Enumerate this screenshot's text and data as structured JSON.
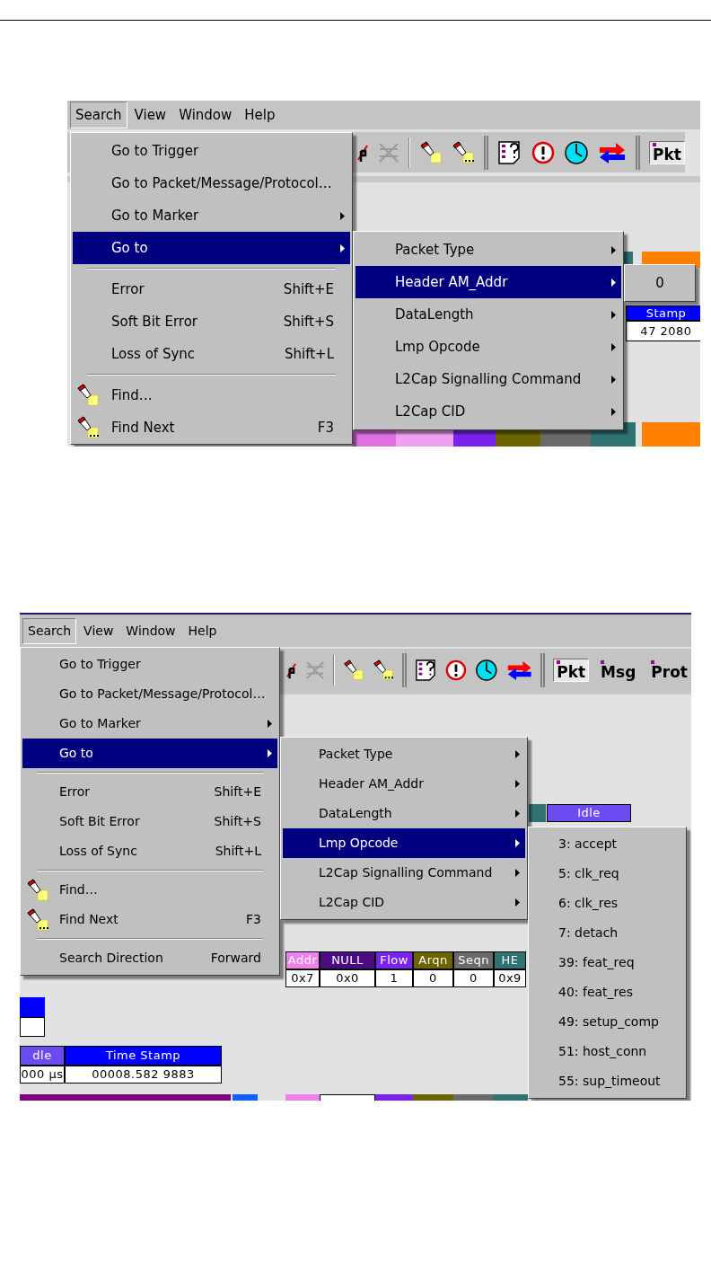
{
  "figures": [
    {
      "menu_bar": [
        {
          "label": "Search",
          "selected": true
        },
        {
          "label": "View",
          "selected": false
        },
        {
          "label": "Window",
          "selected": false
        },
        {
          "label": "Help",
          "selected": false
        }
      ],
      "toolbar_buttons": [
        {
          "label": "Pkt",
          "selected": true
        }
      ],
      "menu": [
        {
          "kind": "item",
          "label": "Go to Trigger",
          "submenu": false,
          "selected": false
        },
        {
          "kind": "item",
          "label": "Go to Packet/Message/Protocol…",
          "submenu": false,
          "selected": false
        },
        {
          "kind": "item",
          "label": "Go to Marker",
          "submenu": true,
          "selected": false
        },
        {
          "kind": "item",
          "label": "Go to",
          "submenu": true,
          "selected": true
        },
        {
          "kind": "separator"
        },
        {
          "kind": "item",
          "label": "Error",
          "shortcut": "Shift+E",
          "submenu": false,
          "selected": false
        },
        {
          "kind": "item",
          "label": "Soft Bit Error",
          "shortcut": "Shift+S",
          "submenu": false,
          "selected": false
        },
        {
          "kind": "item",
          "label": "Loss of Sync",
          "shortcut": "Shift+L",
          "submenu": false,
          "selected": false
        },
        {
          "kind": "separator"
        },
        {
          "kind": "flashlight_item",
          "label": "Find…",
          "submenu": false,
          "selected": false
        },
        {
          "kind": "flashlight_dots_item",
          "label": "Find Next",
          "shortcut": "F3",
          "submenu": false,
          "selected": false
        }
      ],
      "submenu": [
        {
          "label": "Packet Type",
          "submenu": true,
          "selected": false
        },
        {
          "label": "Header AM_Addr",
          "submenu": true,
          "selected": true
        },
        {
          "label": "DataLength",
          "submenu": true,
          "selected": false
        },
        {
          "label": "Lmp Opcode",
          "submenu": true,
          "selected": false
        },
        {
          "label": "L2Cap Signalling Command",
          "submenu": true,
          "selected": false
        },
        {
          "label": "L2Cap CID",
          "submenu": true,
          "selected": false
        }
      ],
      "subsubmenu": [
        {
          "label": "0",
          "submenu": false,
          "selected": false
        }
      ],
      "trace_tables": [
        {
          "headers": [
            {
              "text": "Stamp",
              "color": "#0000ff"
            }
          ],
          "values": [
            "47 2080"
          ]
        }
      ]
    },
    {
      "menu_bar": [
        {
          "label": "Search",
          "selected": true
        },
        {
          "label": "View",
          "selected": false
        },
        {
          "label": "Window",
          "selected": false
        },
        {
          "label": "Help",
          "selected": false
        }
      ],
      "toolbar_buttons": [
        {
          "label": "Pkt",
          "selected": true
        },
        {
          "label": "Msg",
          "selected": false
        },
        {
          "label": "Prot",
          "selected": false
        }
      ],
      "menu": [
        {
          "kind": "item",
          "label": "Go to Trigger",
          "submenu": false,
          "selected": false
        },
        {
          "kind": "item",
          "label": "Go to Packet/Message/Protocol…",
          "submenu": false,
          "selected": false
        },
        {
          "kind": "item",
          "label": "Go to Marker",
          "submenu": true,
          "selected": false
        },
        {
          "kind": "item",
          "label": "Go to",
          "submenu": true,
          "selected": true
        },
        {
          "kind": "separator"
        },
        {
          "kind": "item",
          "label": "Error",
          "shortcut": "Shift+E",
          "submenu": false,
          "selected": false
        },
        {
          "kind": "item",
          "label": "Soft Bit Error",
          "shortcut": "Shift+S",
          "submenu": false,
          "selected": false
        },
        {
          "kind": "item",
          "label": "Loss of Sync",
          "shortcut": "Shift+L",
          "submenu": false,
          "selected": false
        },
        {
          "kind": "separator"
        },
        {
          "kind": "flashlight_item",
          "label": "Find…",
          "submenu": false,
          "selected": false
        },
        {
          "kind": "flashlight_dots_item",
          "label": "Find Next",
          "shortcut": "F3",
          "submenu": false,
          "selected": false
        },
        {
          "kind": "separator"
        },
        {
          "kind": "item",
          "label": "Search Direction",
          "shortcut": "Forward",
          "submenu": false,
          "selected": false
        }
      ],
      "submenu": [
        {
          "label": "Packet Type",
          "submenu": true,
          "selected": false
        },
        {
          "label": "Header AM_Addr",
          "submenu": true,
          "selected": false
        },
        {
          "label": "DataLength",
          "submenu": true,
          "selected": false
        },
        {
          "label": "Lmp Opcode",
          "submenu": true,
          "selected": true
        },
        {
          "label": "L2Cap Signalling Command",
          "submenu": true,
          "selected": false
        },
        {
          "label": "L2Cap CID",
          "submenu": true,
          "selected": false
        }
      ],
      "subsubmenu": [
        {
          "label": "3: accept",
          "submenu": false,
          "selected": false
        },
        {
          "label": "5: clk_req",
          "submenu": false,
          "selected": false
        },
        {
          "label": "6: clk_res",
          "submenu": false,
          "selected": false
        },
        {
          "label": "7: detach",
          "submenu": false,
          "selected": false
        },
        {
          "label": "39: feat_req",
          "submenu": false,
          "selected": false
        },
        {
          "label": "40: feat_res",
          "submenu": false,
          "selected": false
        },
        {
          "label": "49: setup_comp",
          "submenu": false,
          "selected": false
        },
        {
          "label": "51: host_conn",
          "submenu": false,
          "selected": false
        },
        {
          "label": "55: sup_timeout",
          "submenu": false,
          "selected": false
        }
      ],
      "trace_tables": [
        {
          "headers": [
            {
              "text": "Idle",
              "color": "#6a4cf0"
            }
          ]
        },
        {
          "headers": [
            {
              "text": "Addr",
              "color": "#f080f0"
            },
            {
              "text": "NULL",
              "color": "#4b0c82"
            },
            {
              "text": "Flow",
              "color": "#7a22f0"
            },
            {
              "text": "Arqn",
              "color": "#6b6400"
            },
            {
              "text": "Seqn",
              "color": "#6a6a6a"
            },
            {
              "text": "HE",
              "color": "#2e7272"
            }
          ],
          "values": [
            "0x7",
            "0x0",
            "1",
            "0",
            "0",
            "0x9"
          ]
        },
        {
          "headers": [
            {
              "text": "dle",
              "color": "#6a4cf0"
            },
            {
              "text": "Time Stamp",
              "color": "#0000ff"
            }
          ],
          "values": [
            "000 µs",
            "00008.582 9883"
          ]
        }
      ]
    }
  ]
}
